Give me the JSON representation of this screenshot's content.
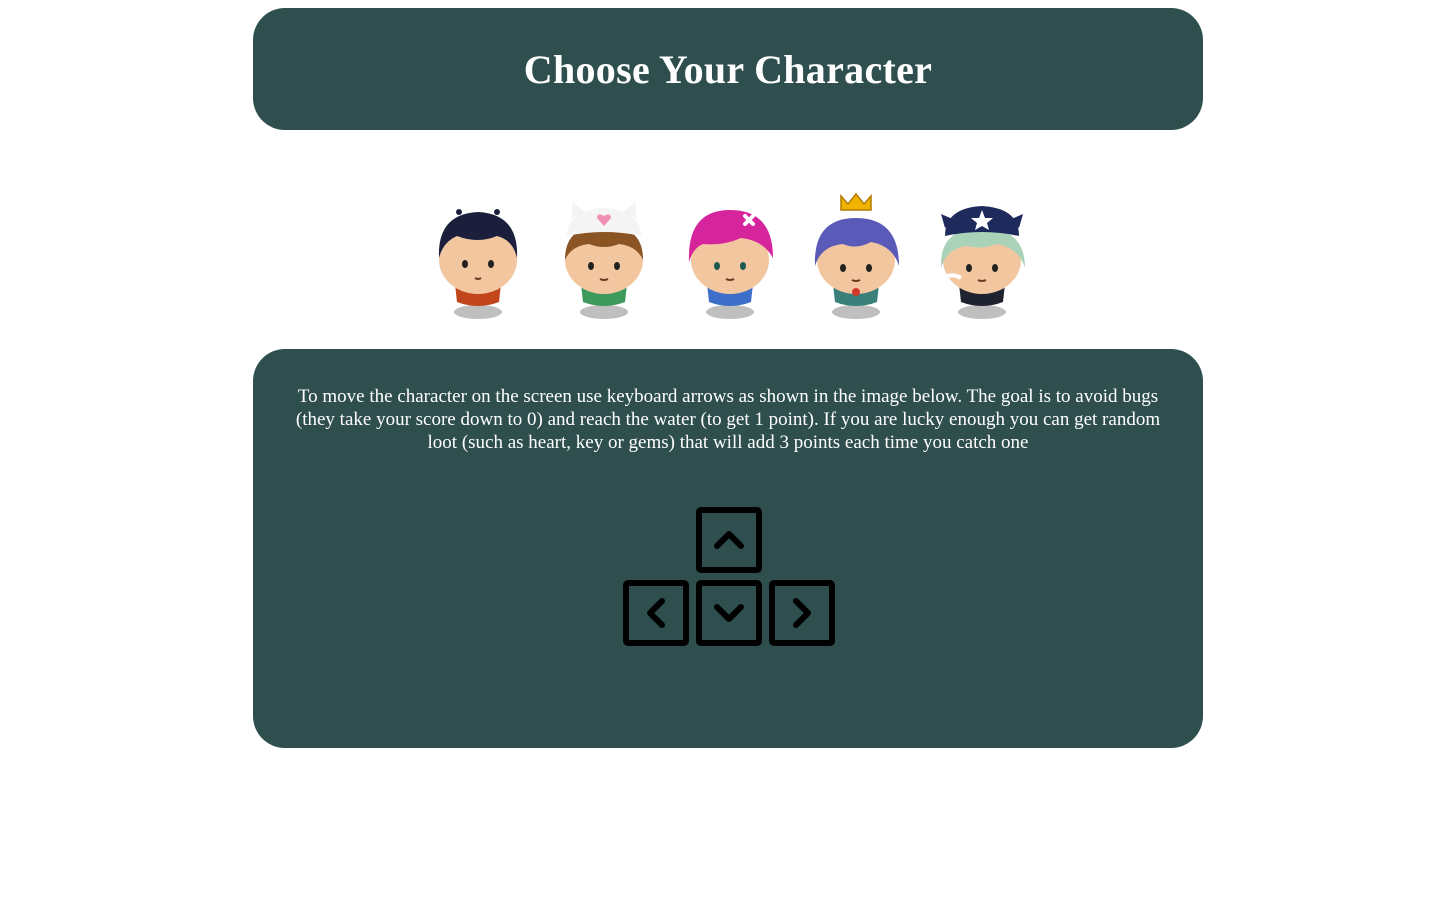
{
  "header": {
    "title": "Choose Your Character"
  },
  "characters": [
    {
      "name": "Boy",
      "icon": "char-boy",
      "hair_color": "#1b1f3b",
      "shirt_color": "#c2461c"
    },
    {
      "name": "Cat Girl",
      "icon": "char-cat-girl",
      "hair_color": "#8a5423",
      "shirt_color": "#3e9a5c"
    },
    {
      "name": "Pink Girl",
      "icon": "char-pink-girl",
      "hair_color": "#d6249c",
      "shirt_color": "#3d6fc9"
    },
    {
      "name": "Princess Girl",
      "icon": "char-princess-girl",
      "hair_color": "#5a5ab8",
      "shirt_color": "#3a7f7a"
    },
    {
      "name": "Horn Girl",
      "icon": "char-horn-girl",
      "hair_color": "#a9d2b8",
      "shirt_color": "#1f2330"
    }
  ],
  "instructions": {
    "text": "To move the character on the screen use keyboard arrows as shown in the image below. The goal is to avoid bugs (they take your score down to 0) and reach the water (to get 1 point). If you are lucky enough you can get random loot (such as heart, key or gems) that will add 3 points each time you catch one"
  },
  "arrow_keys": [
    "up-arrow-key",
    "left-arrow-key",
    "down-arrow-key",
    "right-arrow-key"
  ],
  "colors": {
    "card_background": "#2f4f4f",
    "text": "#ffffff",
    "page_background": "#ffffff"
  }
}
